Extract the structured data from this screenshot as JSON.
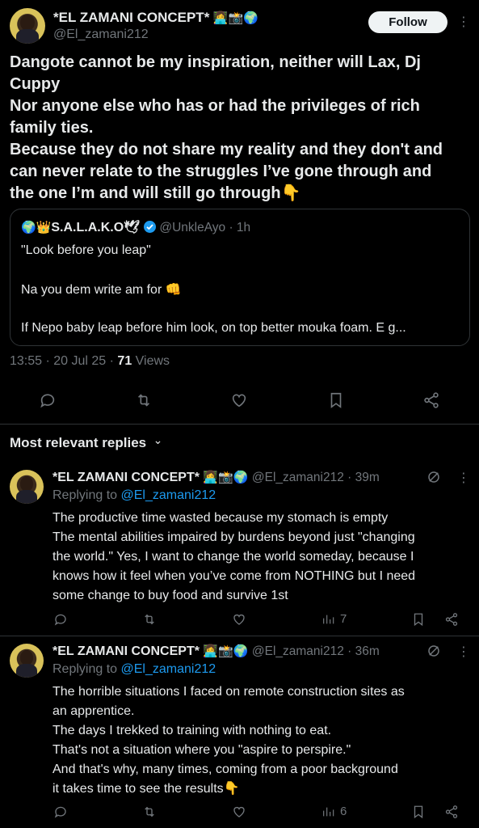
{
  "tweet": {
    "author_name": "*EL ZAMANI CONCEPT*",
    "author_emojis": "👩‍💻📸🌍",
    "author_handle": "@El_zamani212",
    "follow_label": "Follow",
    "more_label": "⋮",
    "text_lines": [
      "Dangote cannot be my inspiration, neither will Lax, Dj",
      "Cuppy",
      "Nor anyone else who has or had the privileges of rich",
      "family ties.",
      "Because they do not share my reality and they don't and",
      "can never relate to the struggles I’ve gone through and",
      "the one I’m and will still go through👇"
    ],
    "quote": {
      "name_prefix": "🌍👑",
      "name": "S.A.L.A.K.O🕊",
      "handle_time": "@UnkleAyo · 1h",
      "lines": [
        "\"Look before you leap\"",
        "Na you dem write am for 👊",
        "If Nepo baby leap before him look, on top better mouka foam. E g..."
      ]
    },
    "time_date": "13:55 · 20 Jul 25 · ",
    "views_count": "71",
    "views_label": " Views"
  },
  "replies_section": {
    "title": "Most relevant replies",
    "chevron": "⌄"
  },
  "replies": [
    {
      "name": "*EL ZAMANI CONCEPT*",
      "emojis": "👩‍💻📸🌍",
      "handle_time": "@El_zamani212 · 39m",
      "replying_prefix": "Replying to ",
      "replying_handle": "@El_zamani212",
      "lines": [
        "The productive time wasted because my stomach is empty",
        "The mental abilities impaired by burdens beyond just \"changing",
        "the world.\" Yes, I want to change the world someday, because I",
        "knows how it feel when you’ve come from NOTHING but I need",
        "some change to buy food and survive 1st"
      ],
      "views": "7"
    },
    {
      "name": "*EL ZAMANI CONCEPT*",
      "emojis": "👩‍💻📸🌍",
      "handle_time": "@El_zamani212 · 36m",
      "replying_prefix": "Replying to ",
      "replying_handle": "@El_zamani212",
      "lines": [
        "The horrible situations I faced on remote construction sites as",
        "an apprentice.",
        "The days I trekked to training with nothing to eat.",
        "That's not a situation where you \"aspire to perspire.\"",
        "And that's why, many times, coming from a poor background",
        "it takes time to see the results👇"
      ],
      "views": "6"
    }
  ]
}
